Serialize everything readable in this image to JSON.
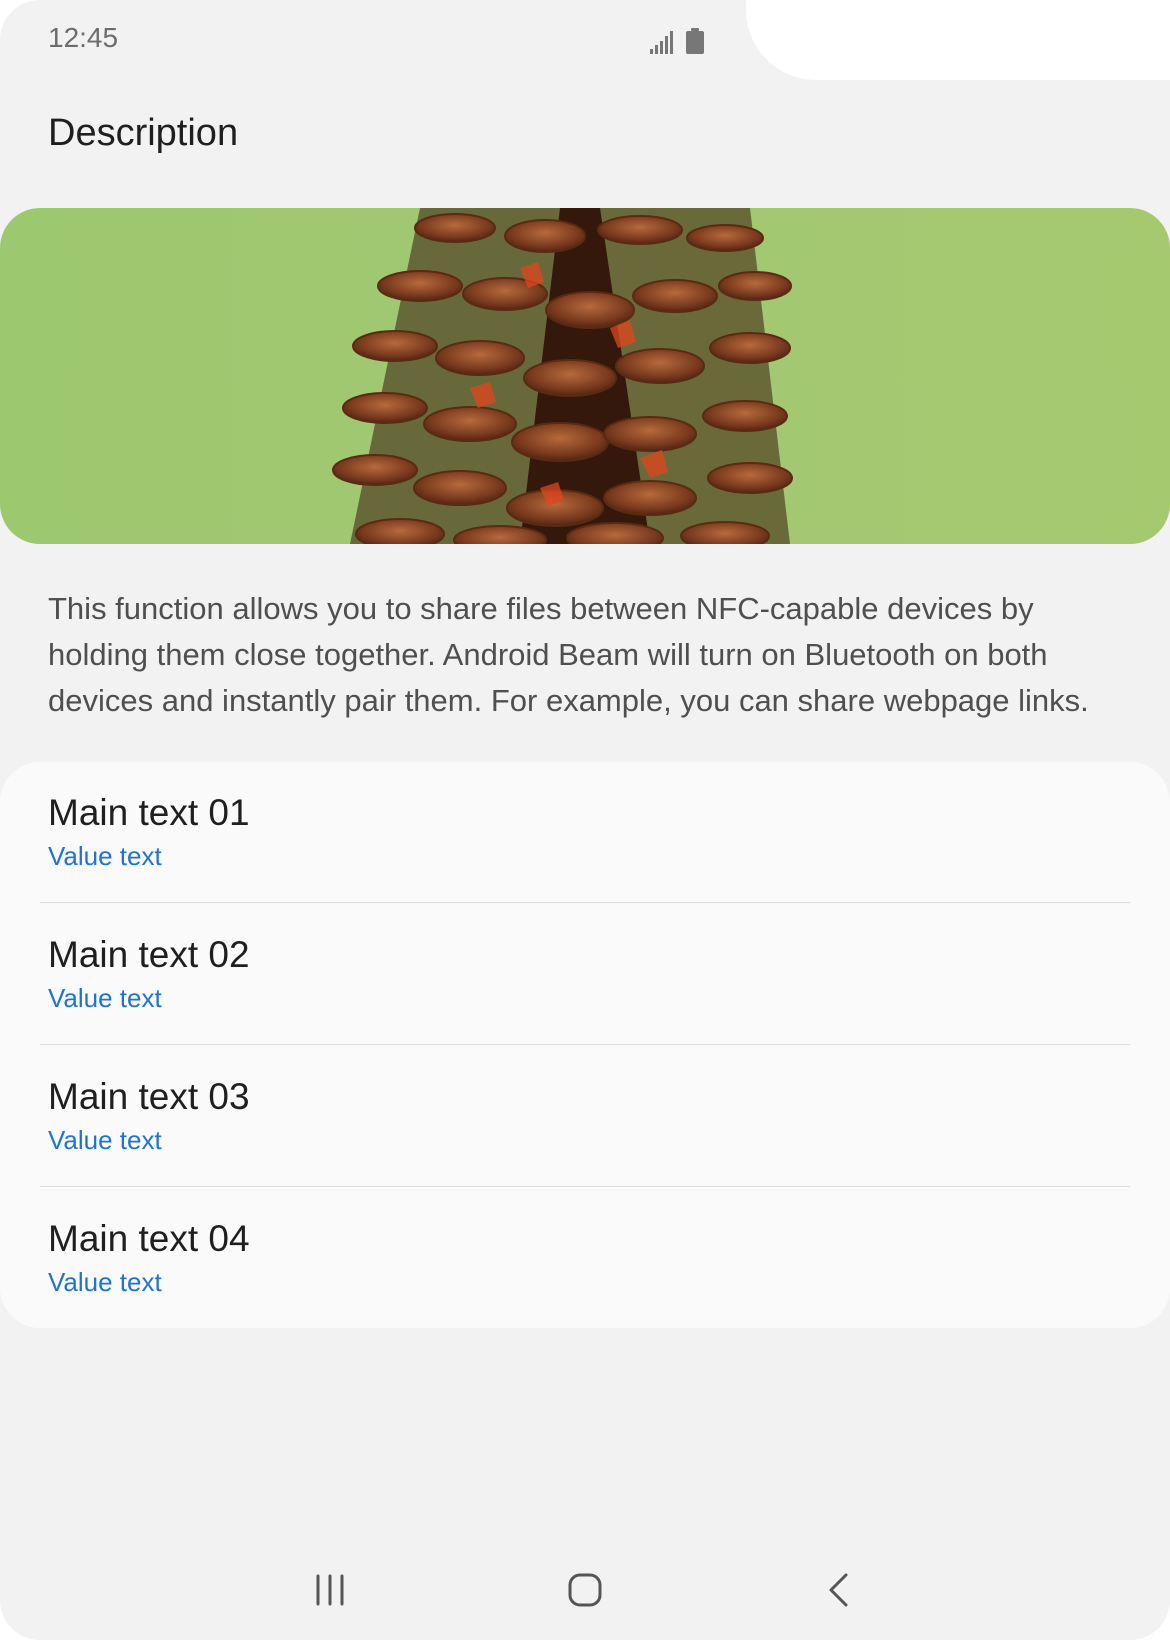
{
  "status_bar": {
    "time": "12:45",
    "signal_icon": "signal-icon",
    "battery_icon": "battery-icon"
  },
  "page": {
    "title": "Description"
  },
  "hero_image": {
    "subject": "pine-cone",
    "background_color": "#a3c972"
  },
  "description": {
    "text": "This function allows you to share files between NFC-capable devices by holding them close together. Android Beam will  turn on Bluetooth on both devices and instantly pair them. For example, you can share webpage links."
  },
  "list": {
    "items": [
      {
        "main": "Main text 01",
        "value": "Value text"
      },
      {
        "main": "Main text 02",
        "value": "Value text"
      },
      {
        "main": "Main text 03",
        "value": "Value text"
      },
      {
        "main": "Main text 04",
        "value": "Value text"
      }
    ]
  },
  "nav_bar": {
    "recents_icon": "recents-icon",
    "home_icon": "home-icon",
    "back_icon": "back-icon"
  },
  "colors": {
    "background": "#f2f2f2",
    "card": "#fafafa",
    "value_text": "#1f73d1",
    "title_text": "#1f1f1f"
  }
}
